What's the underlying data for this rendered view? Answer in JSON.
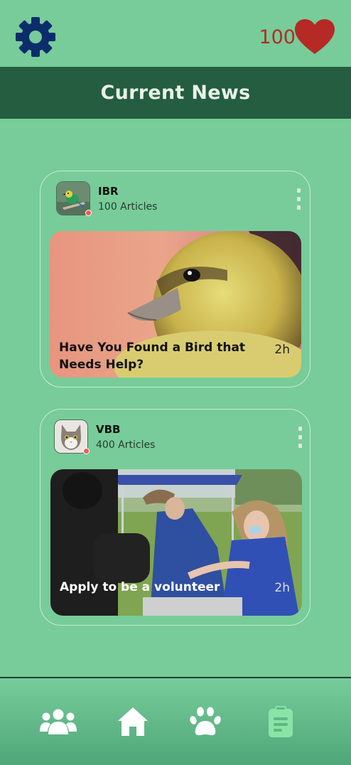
{
  "header": {
    "title": "Current News"
  },
  "likes": {
    "count": "100"
  },
  "news": [
    {
      "org": "IBR",
      "articles": "100 Articles",
      "title": "Have You Found a Bird that Needs Help?",
      "time": "2h"
    },
    {
      "org": "VBB",
      "articles": "400 Articles",
      "title": "Apply to be a volunteer",
      "time": "2h"
    }
  ],
  "icons": {
    "settings": "gear-icon",
    "likes": "heart-icon",
    "nav": [
      "people-icon",
      "home-icon",
      "paw-icon",
      "clipboard-icon"
    ]
  },
  "colors": {
    "background": "#77cc99",
    "header": "#245d3f",
    "gear": "#0b2d6b",
    "heart": "#b52a24",
    "nav_active": "#8be3a6",
    "nav_icon": "#ffffff"
  }
}
